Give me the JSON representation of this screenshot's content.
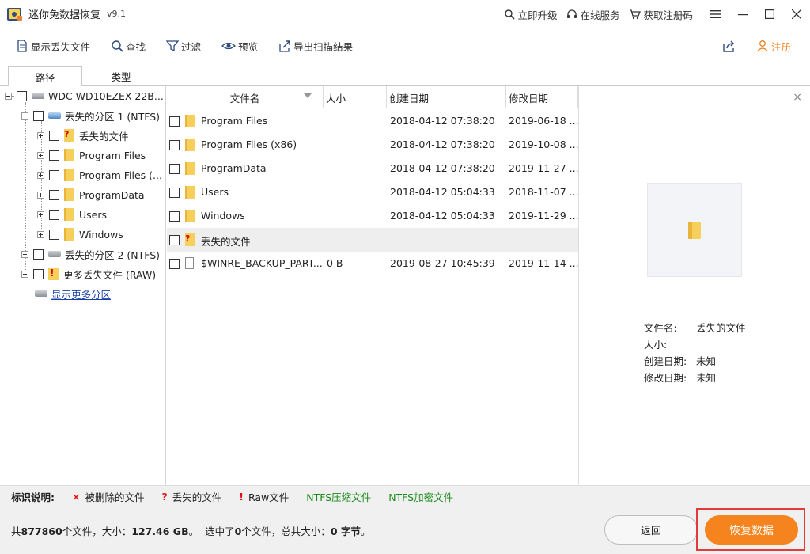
{
  "titlebar": {
    "title": "迷你兔数据恢复",
    "version": "v9.1",
    "links": {
      "upgrade": "立即升级",
      "service": "在线服务",
      "get_code": "获取注册码"
    }
  },
  "toolbar": {
    "show_lost": "显示丢失文件",
    "find": "查找",
    "filter": "过滤",
    "preview": "预览",
    "export": "导出扫描结果",
    "register": "注册"
  },
  "tabs": {
    "path": "路径",
    "type": "类型"
  },
  "tree": {
    "disk": "WDC WD10EZEX-22B...",
    "partition1": "丢失的分区 1 (NTFS)",
    "children": [
      "丢失的文件",
      "Program Files",
      "Program Files (...",
      "ProgramData",
      "Users",
      "Windows"
    ],
    "partition2": "丢失的分区 2 (NTFS)",
    "raw": "更多丢失文件 (RAW)",
    "more_link": "显示更多分区"
  },
  "filelist": {
    "headers": {
      "name": "文件名",
      "size": "大小",
      "created": "创建日期",
      "modified": "修改日期"
    },
    "rows": [
      {
        "name": "Program Files",
        "size": "",
        "created": "2018-04-12 07:38:20",
        "modified": "2019-06-18 ..."
      },
      {
        "name": "Program Files (x86)",
        "size": "",
        "created": "2018-04-12 07:38:20",
        "modified": "2019-10-08 ..."
      },
      {
        "name": "ProgramData",
        "size": "",
        "created": "2018-04-12 07:38:20",
        "modified": "2019-11-27 ..."
      },
      {
        "name": "Users",
        "size": "",
        "created": "2018-04-12 05:04:33",
        "modified": "2018-11-07 ..."
      },
      {
        "name": "Windows",
        "size": "",
        "created": "2018-04-12 05:04:33",
        "modified": "2019-11-29 ..."
      },
      {
        "name": "丢失的文件",
        "size": "",
        "created": "",
        "modified": ""
      },
      {
        "name": "$WINRE_BACKUP_PART...",
        "size": "0 B",
        "created": "2019-08-27 10:45:39",
        "modified": "2019-11-14 ..."
      }
    ]
  },
  "preview": {
    "close": "×",
    "labels": {
      "name": "文件名:",
      "size": "大小:",
      "created": "创建日期:",
      "modified": "修改日期:"
    },
    "values": {
      "name": "丢失的文件",
      "size": "",
      "created": "未知",
      "modified": "未知"
    }
  },
  "legend": {
    "title": "标识说明:",
    "deleted": "被删除的文件",
    "lost": "丢失的文件",
    "raw": "Raw文件",
    "ntfs_compressed": "NTFS压缩文件",
    "ntfs_encrypted": "NTFS加密文件",
    "marks": {
      "deleted": "×",
      "lost": "?",
      "raw": "!"
    }
  },
  "status": {
    "total_prefix": "共",
    "total_files": "877860",
    "total_mid": "个文件，大小：",
    "total_size": "127.46 GB",
    "total_suffix": "。",
    "selected_prefix": "选中了",
    "selected_files": "0",
    "selected_mid": "个文件，总共大小：",
    "selected_size": "0 字节",
    "selected_suffix": "。"
  },
  "buttons": {
    "back": "返回",
    "recover": "恢复数据"
  },
  "colors": {
    "accent": "#f5841f",
    "register": "#f07f1e",
    "highlight_frame": "#e53a3a",
    "link": "#1a3fa8",
    "ntfs_green": "#1a8a1a"
  }
}
